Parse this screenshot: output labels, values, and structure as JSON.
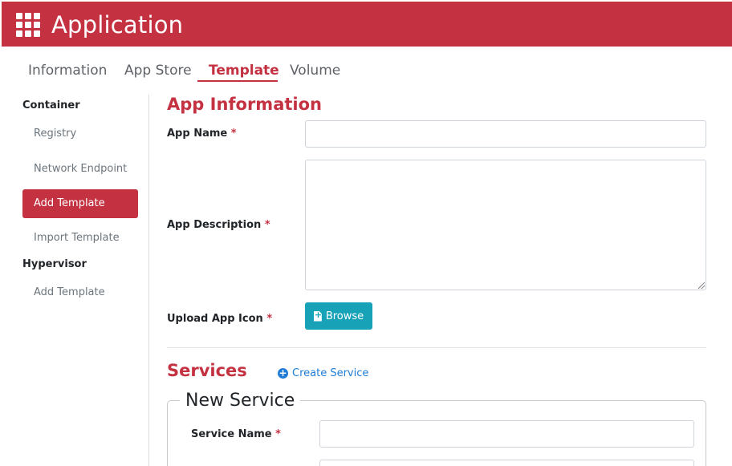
{
  "header": {
    "title": "Application",
    "icon": "grid-icon",
    "color": "#c43242"
  },
  "tabs": [
    {
      "label": "Information",
      "active": false
    },
    {
      "label": "App Store",
      "active": false
    },
    {
      "label": "Template",
      "active": true
    },
    {
      "label": "Volume",
      "active": false
    }
  ],
  "sidebar": {
    "groups": [
      {
        "heading": "Container",
        "items": [
          "Registry",
          "Network Endpoint",
          "Add Template",
          "Import Template"
        ]
      },
      {
        "heading": "Hypervisor",
        "items": [
          "Add Template"
        ]
      }
    ],
    "active_item": "Add Template"
  },
  "app_info": {
    "title": "App Information",
    "app_name_label": "App Name",
    "app_description_label": "App Description",
    "upload_icon_label": "Upload App Icon",
    "browse_label": "Browse",
    "required_mark": "*",
    "app_name_value": "",
    "app_description_value": ""
  },
  "services": {
    "title": "Services",
    "create_label": "Create Service",
    "new_service_legend": "New Service",
    "service_name_label": "Service Name",
    "service_name_value": ""
  },
  "colors": {
    "accent": "#c43242",
    "info_button": "#17a2b8",
    "link": "#1e7bd6"
  }
}
